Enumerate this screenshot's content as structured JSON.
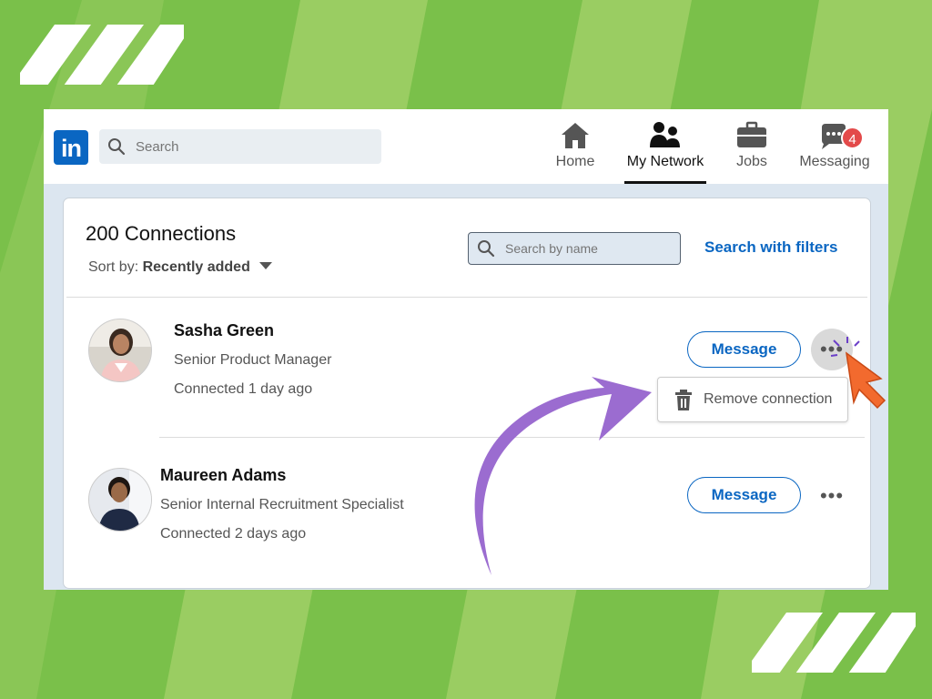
{
  "colors": {
    "background": "#7ac04a",
    "stripe_light": "#9acd62",
    "linkedin_blue": "#0a66c2",
    "badge_red": "#e34a4a",
    "arrow_purple": "#9b6cd0",
    "cursor_orange": "#f26a2e"
  },
  "navbar": {
    "logo_text": "in",
    "search_placeholder": "Search",
    "items": [
      {
        "label": "Home",
        "icon": "home-icon",
        "active": false
      },
      {
        "label": "My Network",
        "icon": "network-icon",
        "active": true
      },
      {
        "label": "Jobs",
        "icon": "briefcase-icon",
        "active": false
      },
      {
        "label": "Messaging",
        "icon": "message-icon",
        "active": false,
        "badge": "4"
      }
    ]
  },
  "connections": {
    "title": "200 Connections",
    "sort_prefix": "Sort by:",
    "sort_value": "Recently added",
    "search_placeholder": "Search by name",
    "filters_link": "Search with filters",
    "people": [
      {
        "name": "Sasha Green",
        "title": "Senior Product Manager",
        "connected": "Connected 1 day ago",
        "message_label": "Message",
        "more_label": "•••"
      },
      {
        "name": "Maureen Adams",
        "title": "Senior Internal Recruitment Specialist",
        "connected": "Connected 2 days ago",
        "message_label": "Message",
        "more_label": "•••"
      }
    ],
    "dropdown": {
      "label": "Remove connection",
      "icon": "trash-icon"
    }
  }
}
